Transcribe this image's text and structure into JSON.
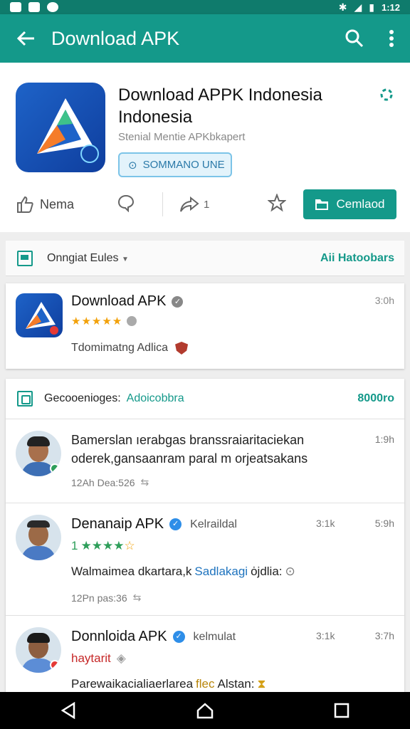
{
  "status_bar": {
    "time": "1:12"
  },
  "app_bar": {
    "title": "Download APK"
  },
  "hero": {
    "app_name": "Download APPK Indonesia Indonesia",
    "developer": "Stenial Mentie APKbkapert",
    "chip_label": "SOMMANO UNE",
    "like_label": "Nema",
    "share_count": "1",
    "download_label": "Cemlaod"
  },
  "section": {
    "label": "Onngiat Eules",
    "link": "Aii Hatoobars"
  },
  "featured": {
    "name": "Download APK",
    "desc": "Tdomimatng Adlica",
    "time": "3:0h",
    "rating": 4.5
  },
  "community": {
    "label": "Gecooenioges:",
    "label_accent": "Adoicobbra",
    "count": "8000ro",
    "posts": [
      {
        "body": "Bamerslan ıerabgas branssraiaritaciekan oderek,gansaanram paral m orjeatsakans",
        "time": "1:9h",
        "footer": "12Ah Dea:526"
      },
      {
        "name": "Denanaip APK",
        "extra": "Kelraildal",
        "meta": "3:1k",
        "time": "5:9h",
        "rating_num": "1",
        "line_start": "Walmaimea dkartara,k",
        "line_link": "Sadlakagi",
        "line_end": "ȯjdlia:",
        "footer": "12Pn pas:36"
      },
      {
        "name": "Donnloida APK",
        "extra": "kelmulat",
        "meta": "3:1k",
        "time": "3:7h",
        "tag": "haytarit",
        "line_start": "Parewaikacialiaerlarea",
        "line_hl": "flec",
        "line_end": "Alstan:"
      }
    ]
  },
  "colors": {
    "primary": "#14998a",
    "star": "#f2a10a",
    "green": "#2e9e5a"
  }
}
